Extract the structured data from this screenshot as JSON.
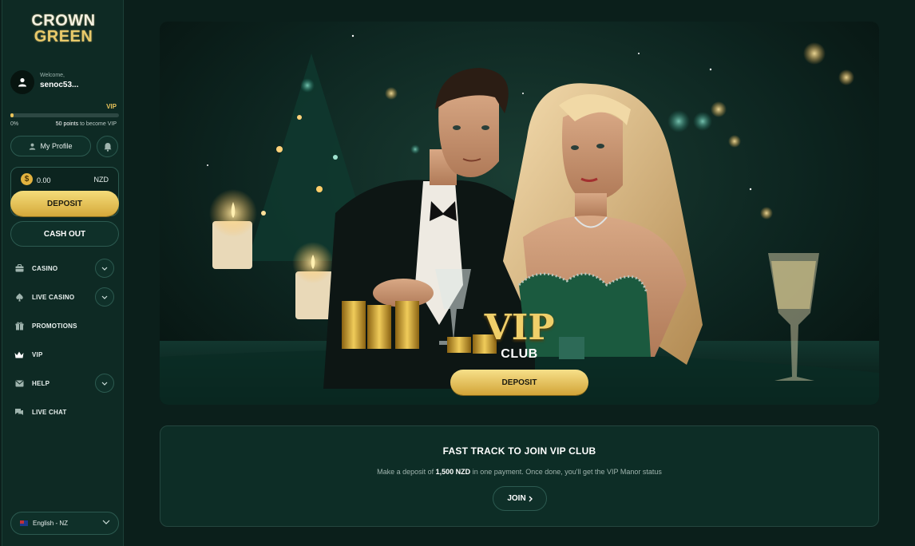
{
  "brand": {
    "line1": "CROWN",
    "line2": "GREEN"
  },
  "user": {
    "welcome": "Welcome,",
    "name": "senoc53..."
  },
  "vip_progress": {
    "level_label": "VIP",
    "percent_label": "0%",
    "points_needed": "50 points",
    "points_suffix": " to become VIP",
    "fraction": 0.03
  },
  "profile": {
    "my_profile_label": "My Profile"
  },
  "balance": {
    "amount": "0.00",
    "currency": "NZD",
    "coin_symbol": "$"
  },
  "buttons": {
    "deposit": "DEPOSIT",
    "cash_out": "CASH OUT"
  },
  "nav": [
    {
      "label": "CASINO",
      "icon": "briefcase-icon",
      "expandable": true
    },
    {
      "label": "LIVE CASINO",
      "icon": "spade-icon",
      "expandable": true
    },
    {
      "label": "PROMOTIONS",
      "icon": "gift-icon",
      "expandable": false
    },
    {
      "label": "VIP",
      "icon": "crown-icon",
      "expandable": false
    },
    {
      "label": "HELP",
      "icon": "mail-icon",
      "expandable": true
    },
    {
      "label": "LIVE CHAT",
      "icon": "chat-icon",
      "expandable": false
    }
  ],
  "language": {
    "label": "English - NZ",
    "flag": "nz-flag-icon"
  },
  "hero": {
    "title": "VIP",
    "subtitle": "CLUB",
    "deposit_label": "DEPOSIT"
  },
  "fast_track": {
    "title": "FAST TRACK TO JOIN VIP CLUB",
    "desc_before": "Make a deposit of ",
    "desc_amount": "1,500 NZD",
    "desc_after": " in one payment. Once done, you'll get the VIP Manor status",
    "join_label": "JOIN"
  },
  "colors": {
    "accent_gold": "#e8c35a",
    "sidebar_bg": "#0e2a24",
    "main_bg": "#0b1f1b",
    "button_border": "#2c5a50"
  }
}
